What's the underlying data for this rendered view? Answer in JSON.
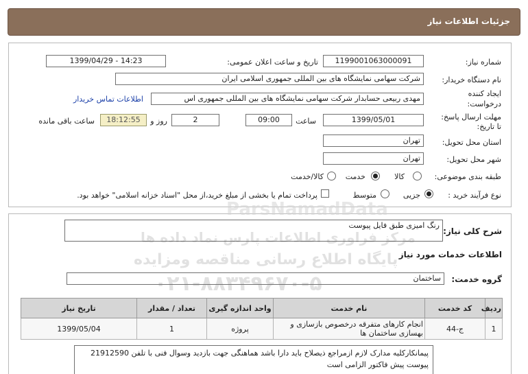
{
  "header": {
    "title": "جزئیات اطلاعات نیاز"
  },
  "form": {
    "need_number_label": "شماره نیاز:",
    "need_number": "1199001063000091",
    "announce_label": "تاریخ و ساعت اعلان عمومی:",
    "announce_value": "1399/04/29 - 14:23",
    "buyer_org_label": "نام دستگاه خریدار:",
    "buyer_org": "شرکت سهامی نمایشگاه های بین المللی جمهوری اسلامی ایران",
    "creator_label_1": "ایجاد کننده",
    "creator_label_2": "درخواست:",
    "creator": "مهدی  ربیعی حسابدار شرکت سهامی نمایشگاه های بین المللی جمهوری اس",
    "contact_link": "اطلاعات تماس خریدار",
    "deadline_label_1": "مهلت ارسال پاسخ:",
    "deadline_label_2": "تا تاریخ:",
    "deadline_date": "1399/05/01",
    "time_label": "ساعت",
    "deadline_time": "09:00",
    "days_value": "2",
    "days_label": "روز و",
    "remaining_time": "18:12:55",
    "remaining_label": "ساعت باقی مانده",
    "province_label": "استان محل تحویل:",
    "province": "تهران",
    "city_label": "شهر محل تحویل:",
    "city": "تهران",
    "category_label": "طبقه بندی موضوعی:",
    "category_options": [
      "کالا",
      "خدمت",
      "کالا/خدمت"
    ],
    "category_selected": "خدمت",
    "process_label": "نوع فرآیند خرید :",
    "process_options": [
      "جزیی",
      "متوسط"
    ],
    "process_selected": "جزیی",
    "payment_note": "پرداخت تمام یا بخشی از مبلغ خرید،از محل \"اسناد خزانه اسلامی\" خواهد بود."
  },
  "description": {
    "label": "شرح کلی نیاز:",
    "text": "رنگ امیزی طبق فایل پیوست"
  },
  "services_info": {
    "title": "اطلاعات خدمات مورد نیاز",
    "group_label": "گروه خدمت:",
    "group_value": "ساختمان"
  },
  "table": {
    "headers": [
      "ردیف",
      "کد خدمت",
      "نام خدمت",
      "واحد اندازه گیری",
      "تعداد / مقدار",
      "تاریخ نیاز"
    ],
    "rows": [
      {
        "row": "1",
        "code": "ج-44",
        "name": "انجام کارهای متفرقه درخصوص بازسازی و بهسازی ساختمان ها",
        "unit": "پروژه",
        "qty": "1",
        "date": "1399/05/04"
      }
    ]
  },
  "buyer_notes": {
    "text": "پیمانکارکلیه مدارک لازم ازمراجع ذیصلاح باید دارا باشد هماهنگی جهت بازدید وسوال فنی با تلفن 21912590 پیوست پیش فاکتور الزامی است"
  },
  "watermark": {
    "brand": "ParsNamadData",
    "line1": "مرکز فراوری اطلاعات پارس نماد داده ها",
    "line2": "پایگاه اطلاع رسانی مناقصه ومزایده",
    "phone": "۰۲۱-۸۸۳۴۹۶۷۰-۵"
  }
}
